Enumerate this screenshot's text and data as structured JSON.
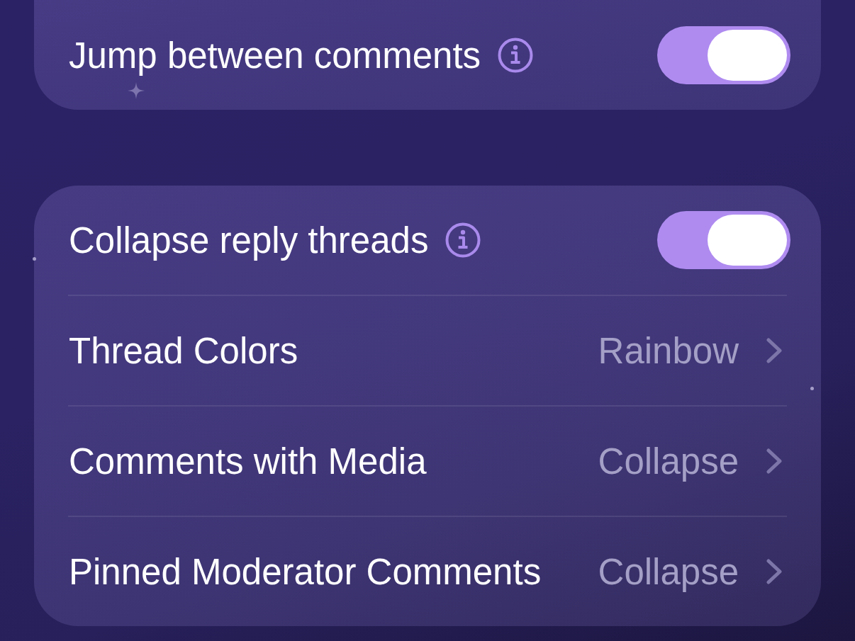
{
  "groups": [
    {
      "rows": [
        {
          "kind": "toggle",
          "label": "Jump between comments",
          "info": true,
          "on": true
        }
      ]
    },
    {
      "rows": [
        {
          "kind": "toggle",
          "label": "Collapse reply threads",
          "info": true,
          "on": true
        },
        {
          "kind": "link",
          "label": "Thread Colors",
          "value": "Rainbow"
        },
        {
          "kind": "link",
          "label": "Comments with Media",
          "value": "Collapse"
        },
        {
          "kind": "link",
          "label": "Pinned Moderator Comments",
          "value": "Collapse"
        }
      ]
    }
  ]
}
